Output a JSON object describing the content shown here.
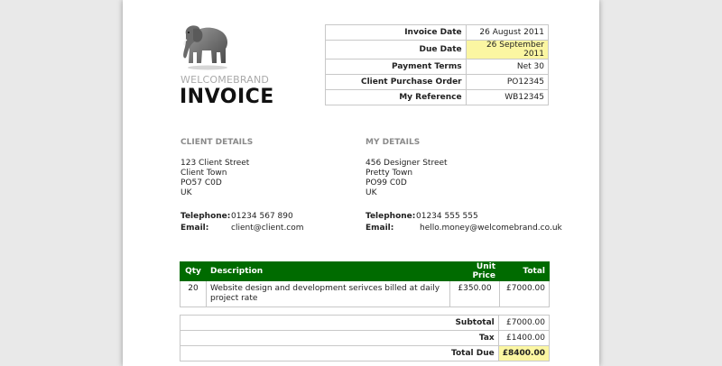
{
  "brand": "WELCOMEBRAND",
  "document_title": "INVOICE",
  "meta": [
    {
      "label": "Invoice Date",
      "value": "26 August 2011",
      "highlight": false
    },
    {
      "label": "Due Date",
      "value": "26 September 2011",
      "highlight": true
    },
    {
      "label": "Payment Terms",
      "value": "Net 30",
      "highlight": false
    },
    {
      "label": "Client Purchase Order",
      "value": "PO12345",
      "highlight": false
    },
    {
      "label": "My Reference",
      "value": "WB12345",
      "highlight": false
    }
  ],
  "client": {
    "heading": "CLIENT DETAILS",
    "address": [
      "123 Client Street",
      "Client Town",
      "PO57 C0D",
      "UK"
    ],
    "telephone_label": "Telephone:",
    "telephone": "01234 567 890",
    "email_label": "Email:",
    "email": "client@client.com"
  },
  "mine": {
    "heading": "MY DETAILS",
    "address": [
      "456 Designer Street",
      "Pretty Town",
      "PO99 C0D",
      "UK"
    ],
    "telephone_label": "Telephone:",
    "telephone": "01234 555 555",
    "email_label": "Email:",
    "email": "hello.money@welcomebrand.co.uk"
  },
  "items_table": {
    "headers": {
      "qty": "Qty",
      "description": "Description",
      "unit_price": "Unit Price",
      "total": "Total"
    },
    "rows": [
      {
        "qty": "20",
        "description": "Website design and development serivces billed at daily project rate",
        "unit_price": "£350.00",
        "total": "£7000.00"
      }
    ]
  },
  "totals": [
    {
      "label": "Subtotal",
      "value": "£7000.00",
      "highlight": false
    },
    {
      "label": "Tax",
      "value": "£1400.00",
      "highlight": false
    },
    {
      "label": "Total Due",
      "value": "£8400.00",
      "highlight": true
    }
  ],
  "colors": {
    "header_green": "#006b00",
    "highlight_yellow": "#fbf6a2"
  },
  "icons": {
    "logo": "elephant-logo"
  }
}
